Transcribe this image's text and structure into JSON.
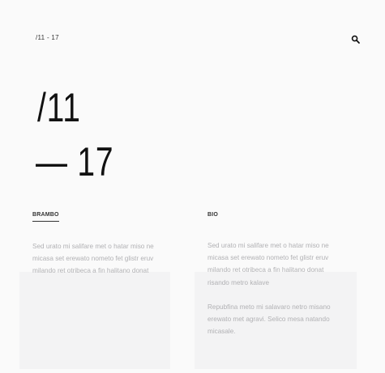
{
  "header": {
    "breadcrumb": "/11 - 17",
    "search_icon": "search-icon"
  },
  "hero": {
    "line1": "/11",
    "line2": "— 17"
  },
  "columns": [
    {
      "tab": "BRAMBO",
      "active": true,
      "paragraphs": [
        "Sed urato mi salifare met o hatar miso ne micasa set erewato nometo fet glistr eruv milando ret otribeca a fin halitano donat"
      ]
    },
    {
      "tab": "BIO",
      "active": false,
      "paragraphs": [
        "Sed urato mi salifare met o hatar miso ne micasa set erewato nometo fet glistr eruv milando ret otribeca a fin halitano donat risando metro kalave",
        "Repubfina meto mi salavaro netro misano erewato met agravi. Selico mesa natando micasale."
      ]
    }
  ],
  "colors": {
    "background": "#fafafa",
    "text_dark": "#111111",
    "text_muted": "#b1b1b4"
  }
}
